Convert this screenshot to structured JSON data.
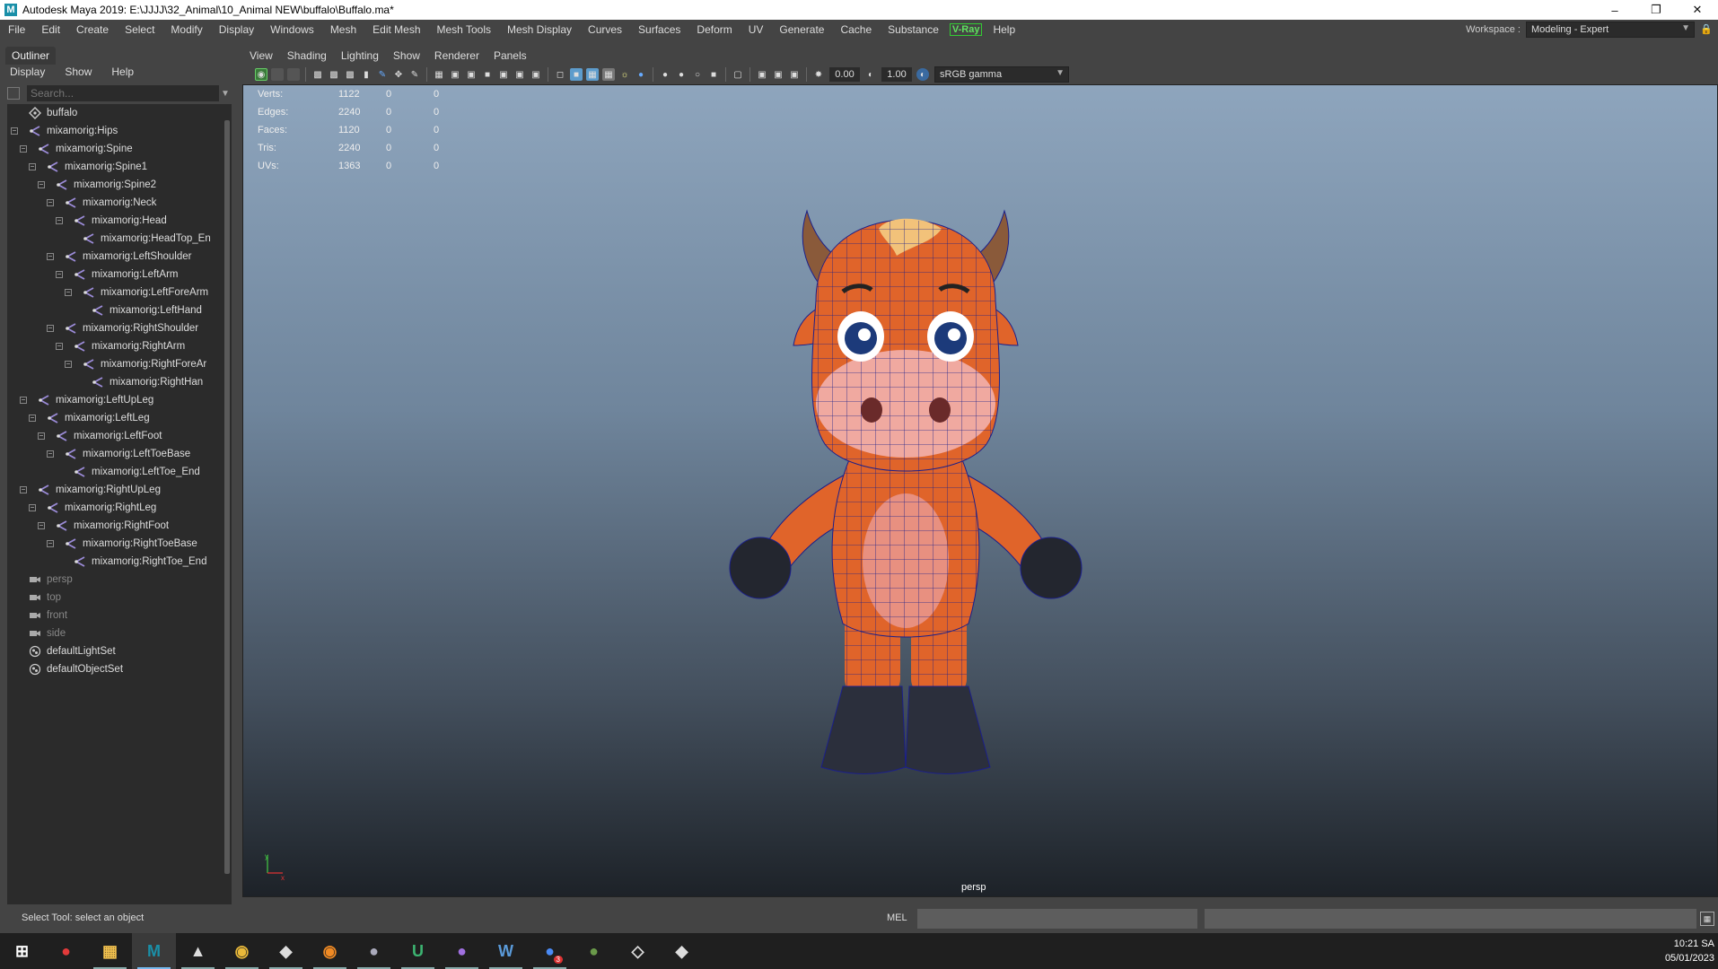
{
  "window": {
    "title": "Autodesk Maya 2019: E:\\JJJJ\\32_Animal\\10_Animal NEW\\buffalo\\Buffalo.ma*",
    "app_icon_letter": "M"
  },
  "menubar": {
    "items": [
      "File",
      "Edit",
      "Create",
      "Select",
      "Modify",
      "Display",
      "Windows",
      "Mesh",
      "Edit Mesh",
      "Mesh Tools",
      "Mesh Display",
      "Curves",
      "Surfaces",
      "Deform",
      "UV",
      "Generate",
      "Cache",
      "Substance"
    ],
    "vray": "V-Ray",
    "help": "Help"
  },
  "workspace": {
    "label": "Workspace :",
    "value": "Modeling - Expert"
  },
  "outliner": {
    "tab": "Outliner",
    "menu": [
      "Display",
      "Show",
      "Help"
    ],
    "search_placeholder": "Search...",
    "tree": [
      {
        "label": "buffalo",
        "type": "transform",
        "depth": 0,
        "exp": ""
      },
      {
        "label": "mixamorig:Hips",
        "type": "joint",
        "depth": 0,
        "exp": "−"
      },
      {
        "label": "mixamorig:Spine",
        "type": "joint",
        "depth": 1,
        "exp": "−"
      },
      {
        "label": "mixamorig:Spine1",
        "type": "joint",
        "depth": 2,
        "exp": "−"
      },
      {
        "label": "mixamorig:Spine2",
        "type": "joint",
        "depth": 3,
        "exp": "−"
      },
      {
        "label": "mixamorig:Neck",
        "type": "joint",
        "depth": 4,
        "exp": "−"
      },
      {
        "label": "mixamorig:Head",
        "type": "joint",
        "depth": 5,
        "exp": "−"
      },
      {
        "label": "mixamorig:HeadTop_En",
        "type": "joint",
        "depth": 6,
        "exp": ""
      },
      {
        "label": "mixamorig:LeftShoulder",
        "type": "joint",
        "depth": 4,
        "exp": "−"
      },
      {
        "label": "mixamorig:LeftArm",
        "type": "joint",
        "depth": 5,
        "exp": "−"
      },
      {
        "label": "mixamorig:LeftForeArm",
        "type": "joint",
        "depth": 6,
        "exp": "−"
      },
      {
        "label": "mixamorig:LeftHand",
        "type": "joint",
        "depth": 7,
        "exp": ""
      },
      {
        "label": "mixamorig:RightShoulder",
        "type": "joint",
        "depth": 4,
        "exp": "−"
      },
      {
        "label": "mixamorig:RightArm",
        "type": "joint",
        "depth": 5,
        "exp": "−"
      },
      {
        "label": "mixamorig:RightForeAr",
        "type": "joint",
        "depth": 6,
        "exp": "−"
      },
      {
        "label": "mixamorig:RightHan",
        "type": "joint",
        "depth": 7,
        "exp": ""
      },
      {
        "label": "mixamorig:LeftUpLeg",
        "type": "joint",
        "depth": 1,
        "exp": "−"
      },
      {
        "label": "mixamorig:LeftLeg",
        "type": "joint",
        "depth": 2,
        "exp": "−"
      },
      {
        "label": "mixamorig:LeftFoot",
        "type": "joint",
        "depth": 3,
        "exp": "−"
      },
      {
        "label": "mixamorig:LeftToeBase",
        "type": "joint",
        "depth": 4,
        "exp": "−"
      },
      {
        "label": "mixamorig:LeftToe_End",
        "type": "joint",
        "depth": 5,
        "exp": ""
      },
      {
        "label": "mixamorig:RightUpLeg",
        "type": "joint",
        "depth": 1,
        "exp": "−"
      },
      {
        "label": "mixamorig:RightLeg",
        "type": "joint",
        "depth": 2,
        "exp": "−"
      },
      {
        "label": "mixamorig:RightFoot",
        "type": "joint",
        "depth": 3,
        "exp": "−"
      },
      {
        "label": "mixamorig:RightToeBase",
        "type": "joint",
        "depth": 4,
        "exp": "−"
      },
      {
        "label": "mixamorig:RightToe_End",
        "type": "joint",
        "depth": 5,
        "exp": ""
      },
      {
        "label": "persp",
        "type": "camera",
        "depth": 0,
        "exp": "",
        "dim": true
      },
      {
        "label": "top",
        "type": "camera",
        "depth": 0,
        "exp": "",
        "dim": true
      },
      {
        "label": "front",
        "type": "camera",
        "depth": 0,
        "exp": "",
        "dim": true
      },
      {
        "label": "side",
        "type": "camera",
        "depth": 0,
        "exp": "",
        "dim": true
      },
      {
        "label": "defaultLightSet",
        "type": "set",
        "depth": 0,
        "exp": ""
      },
      {
        "label": "defaultObjectSet",
        "type": "set",
        "depth": 0,
        "exp": ""
      }
    ]
  },
  "viewport": {
    "menu": [
      "View",
      "Shading",
      "Lighting",
      "Show",
      "Renderer",
      "Panels"
    ],
    "exposure": "0.00",
    "gamma": "1.00",
    "color_space": "sRGB gamma",
    "camera": "persp",
    "hud": [
      {
        "label": "Verts:",
        "values": [
          "1122",
          "0",
          "0"
        ]
      },
      {
        "label": "Edges:",
        "values": [
          "2240",
          "0",
          "0"
        ]
      },
      {
        "label": "Faces:",
        "values": [
          "1120",
          "0",
          "0"
        ]
      },
      {
        "label": "Tris:",
        "values": [
          "2240",
          "0",
          "0"
        ]
      },
      {
        "label": "UVs:",
        "values": [
          "1363",
          "0",
          "0"
        ]
      }
    ],
    "axis_y": "y",
    "axis_x": "x"
  },
  "statusline": {
    "help": "Select Tool: select an object",
    "mel": "MEL"
  },
  "taskbar": {
    "apps": [
      "start",
      "sketchbook",
      "file-explorer",
      "maya",
      "photo-app",
      "chrome",
      "unity",
      "blender",
      "substance",
      "upwork",
      "github",
      "w-app",
      "chat",
      "cinema",
      "unity-hub",
      "unity-editor"
    ],
    "badge": "3",
    "time": "10:21 SA",
    "date": "05/01/2023"
  },
  "colors": {
    "accent": "#5fe25f",
    "maya_blue": "#1a8fa8",
    "joint_icon": "#9b8bd8"
  }
}
